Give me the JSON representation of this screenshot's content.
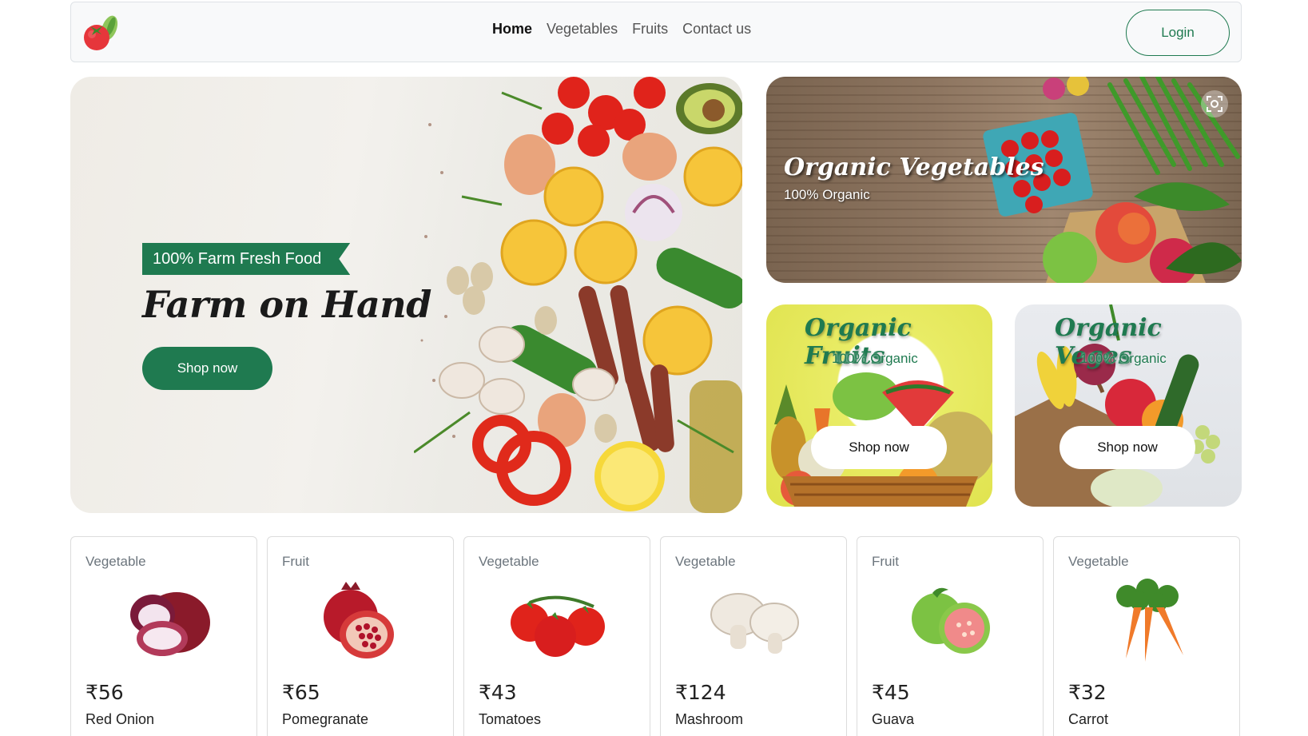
{
  "nav": {
    "logo_icon": "tomato-logo-icon",
    "links": [
      {
        "label": "Home",
        "active": true
      },
      {
        "label": "Vegetables",
        "active": false
      },
      {
        "label": "Fruits",
        "active": false
      },
      {
        "label": "Contact us",
        "active": false
      }
    ],
    "login_label": "Login"
  },
  "hero": {
    "badge": "100% Farm Fresh Food",
    "title": "Farm on Hand",
    "button": "Shop now"
  },
  "promos": {
    "vegetables": {
      "title": "Organic Vegetables",
      "subtitle": "100% Organic"
    },
    "fruits": {
      "title": "Organic Fruits",
      "subtitle": "100% Organic",
      "button": "Shop now"
    },
    "veges": {
      "title": "Organic Veges",
      "subtitle": "100% Organic",
      "button": "Shop now"
    }
  },
  "products": [
    {
      "category": "Vegetable",
      "price": "₹56",
      "name": "Red Onion",
      "icon": "red-onion-icon"
    },
    {
      "category": "Fruit",
      "price": "₹65",
      "name": "Pomegranate",
      "icon": "pomegranate-icon"
    },
    {
      "category": "Vegetable",
      "price": "₹43",
      "name": "Tomatoes",
      "icon": "tomatoes-icon"
    },
    {
      "category": "Vegetable",
      "price": "₹124",
      "name": "Mashroom",
      "icon": "mushroom-icon"
    },
    {
      "category": "Fruit",
      "price": "₹45",
      "name": "Guava",
      "icon": "guava-icon"
    },
    {
      "category": "Vegetable",
      "price": "₹32",
      "name": "Carrot",
      "icon": "carrot-icon"
    }
  ],
  "colors": {
    "brand_green": "#1f7a50",
    "navbar_bg": "#f8f9fa"
  }
}
